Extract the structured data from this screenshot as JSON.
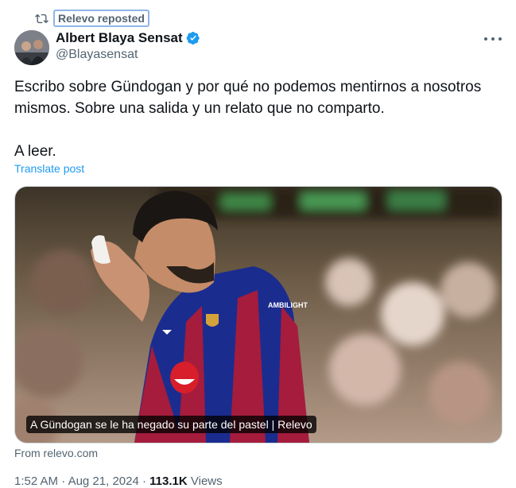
{
  "repost": {
    "label": "Relevo reposted",
    "icon": "repost-icon"
  },
  "author": {
    "name": "Albert Blaya Sensat",
    "handle": "@Blayasensat",
    "verified_icon": "verified-badge-icon",
    "verified_color": "#1d9bf0"
  },
  "post": {
    "paragraphs": [
      "Escribo sobre Gündogan y por qué no podemos mentirnos a nosotros mismos. Sobre una salida y un relato que no comparto.",
      "A leer."
    ],
    "translate_label": "Translate post"
  },
  "media": {
    "caption": "A Gündogan se le ha negado su parte del pastel | Relevo",
    "shirt_sponsor": "AMBILIGHT"
  },
  "link_source": "From relevo.com",
  "meta": {
    "time": "1:52 AM",
    "separator": "·",
    "date": "Aug 21, 2024",
    "views_count": "113.1K",
    "views_label": "Views"
  },
  "colors": {
    "accent": "#1d9bf0",
    "muted": "#536471",
    "text": "#0f1419"
  }
}
